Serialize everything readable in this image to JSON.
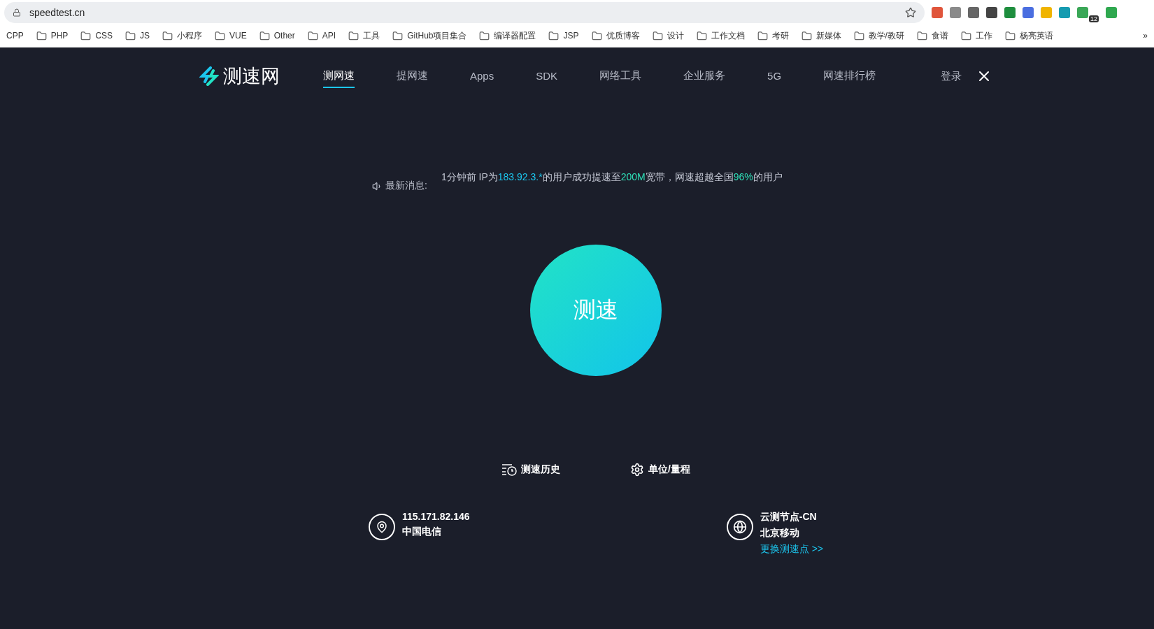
{
  "browser": {
    "url": "speedtest.cn",
    "extension_badge": "12",
    "bookmarks": [
      "CPP",
      "PHP",
      "CSS",
      "JS",
      "小程序",
      "VUE",
      "Other",
      "API",
      "工具",
      "GitHub项目集合",
      "编译器配置",
      "JSP",
      "优质博客",
      "设计",
      "工作文档",
      "考研",
      "新媒体",
      "教学/教研",
      "食谱",
      "工作",
      "杨亮英语"
    ],
    "overflow": "»"
  },
  "site": {
    "logo": "测速网",
    "nav": [
      {
        "label": "测网速",
        "selected": true
      },
      {
        "label": "提网速",
        "selected": false
      },
      {
        "label": "Apps",
        "selected": false
      },
      {
        "label": "SDK",
        "selected": false
      },
      {
        "label": "网络工具",
        "selected": false
      },
      {
        "label": "企业服务",
        "selected": false
      },
      {
        "label": "5G",
        "selected": false
      },
      {
        "label": "网速排行榜",
        "selected": false
      }
    ],
    "login": "登录"
  },
  "news": {
    "label": "最新消息:",
    "segments": [
      {
        "text": "1分钟前 IP为",
        "color": "#c4c8d4"
      },
      {
        "text": "183.92.3.*",
        "color": "#1cc6ee"
      },
      {
        "text": "的用户成功提速至",
        "color": "#c4c8d4"
      },
      {
        "text": "200M",
        "color": "#2fe0b8"
      },
      {
        "text": "宽带，网速超越全国",
        "color": "#c4c8d4"
      },
      {
        "text": "96%",
        "color": "#2fe0b8"
      },
      {
        "text": "的用户",
        "color": "#c4c8d4"
      }
    ]
  },
  "start_button": "测速",
  "actions": [
    {
      "kind": "history",
      "label": "测速历史"
    },
    {
      "kind": "settings",
      "label": "单位/量程"
    }
  ],
  "client": {
    "ip": "115.171.82.146",
    "isp": "中国电信"
  },
  "server": {
    "name": "云测节点-CN",
    "isp": "北京移动",
    "change_link": "更换测速点 >>"
  }
}
